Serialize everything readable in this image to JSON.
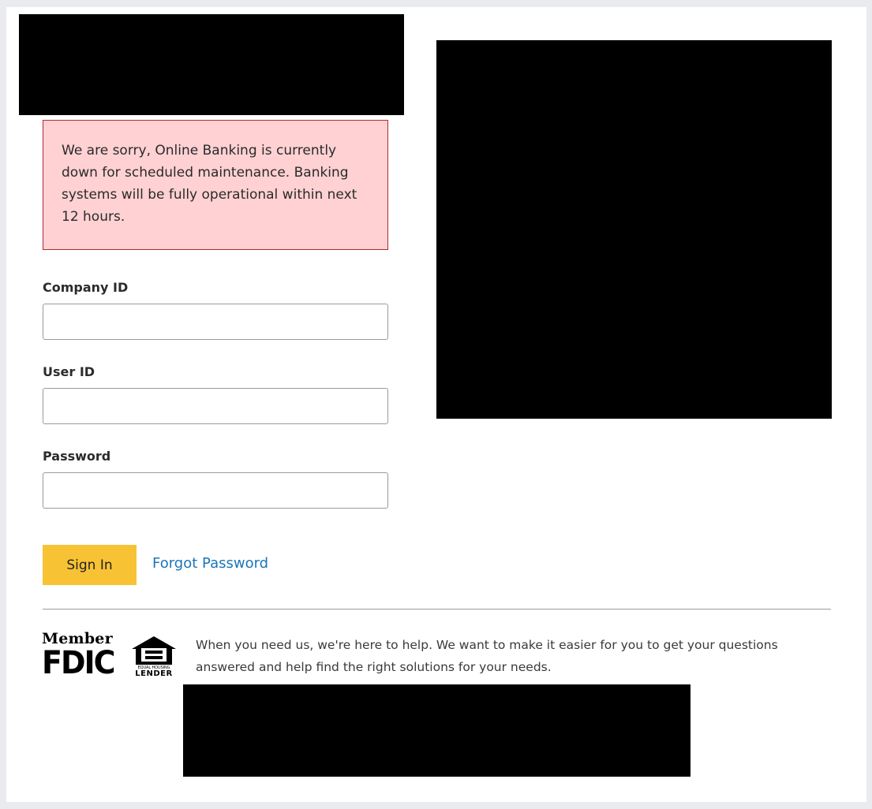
{
  "alert": {
    "message": "We are sorry, Online Banking is currently down for scheduled maintenance. Banking systems will be fully operational within next 12 hours."
  },
  "form": {
    "company_id": {
      "label": "Company ID",
      "value": ""
    },
    "user_id": {
      "label": "User ID",
      "value": ""
    },
    "password": {
      "label": "Password",
      "value": ""
    },
    "sign_in_label": "Sign In",
    "forgot_password_label": "Forgot Password"
  },
  "footer": {
    "fdic_member": "Member",
    "fdic_name": "FDIC",
    "ehl_line1": "EQUAL HOUSING",
    "ehl_line2": "LENDER",
    "help_text": "When you need us, we're here to help. We want to make it easier for you to get your questions answered and help find the right solutions for your needs."
  },
  "colors": {
    "alert_background": "#ffd1d3",
    "alert_border": "#b22a2f",
    "sign_in_button": "#f7c234",
    "link": "#1a75b8"
  },
  "icons": {
    "fdic_logo": "fdic-logo-icon",
    "equal_housing": "equal-housing-lender-icon"
  }
}
